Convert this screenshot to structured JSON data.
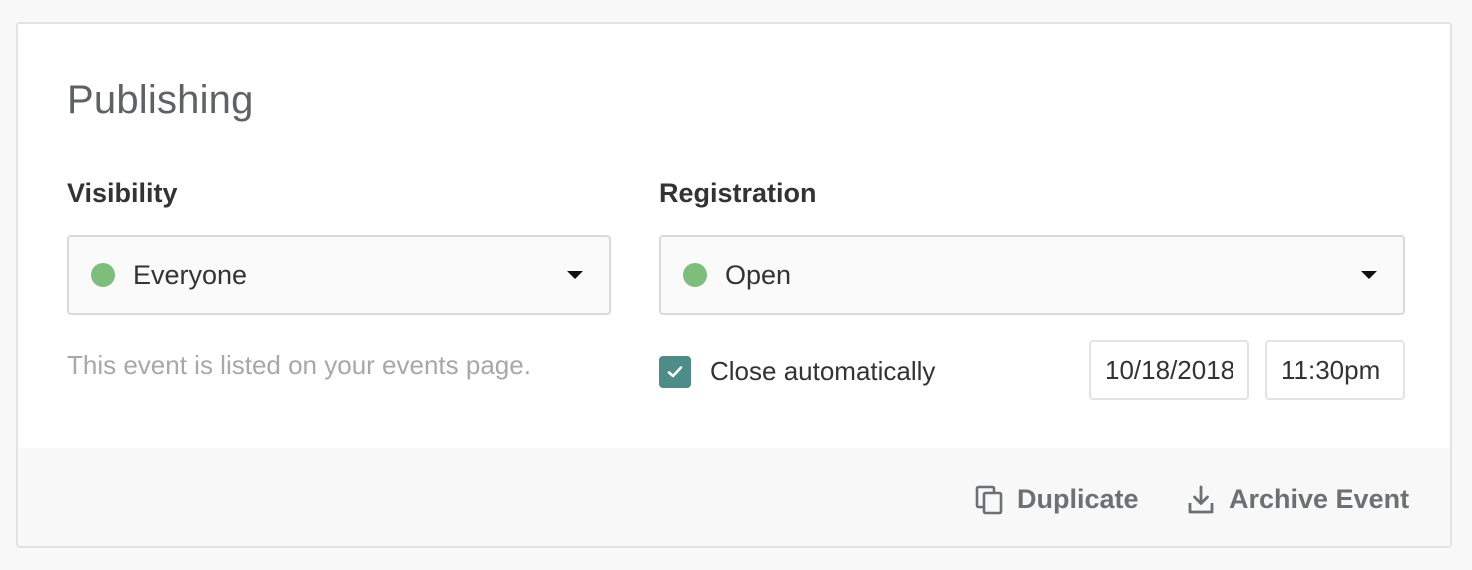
{
  "publishing": {
    "title": "Publishing",
    "visibility": {
      "label": "Visibility",
      "selected": "Everyone",
      "status_color": "#7dbf7a",
      "helper_text": "This event is listed on your events page."
    },
    "registration": {
      "label": "Registration",
      "selected": "Open",
      "status_color": "#7dbf7a",
      "close_automatically": {
        "label": "Close automatically",
        "checked": true
      },
      "close_date": "10/18/2018",
      "close_time": "11:30pm"
    }
  },
  "footer": {
    "duplicate_label": "Duplicate",
    "archive_label": "Archive Event",
    "duplicate_icon": "duplicate-icon",
    "archive_icon": "download-icon"
  },
  "colors": {
    "accent": "#4e8c8a",
    "status_green": "#7dbf7a"
  }
}
